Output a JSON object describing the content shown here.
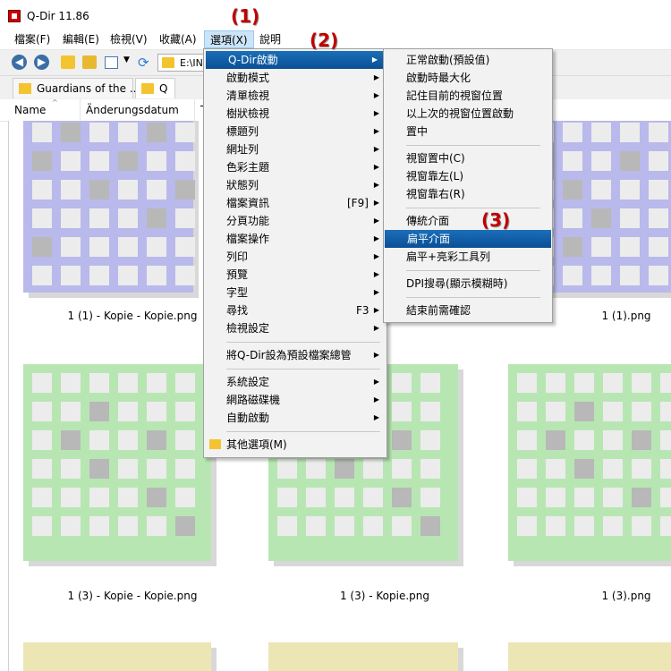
{
  "window": {
    "title": "Q-Dir 11.86"
  },
  "menubar": {
    "items": [
      {
        "label": "檔案(F)"
      },
      {
        "label": "編輯(E)"
      },
      {
        "label": "檢視(V)"
      },
      {
        "label": "收藏(A)"
      },
      {
        "label": "選項(X)"
      },
      {
        "label": "說明"
      }
    ]
  },
  "toolbar": {
    "address": "E:\\INI"
  },
  "tabs": [
    {
      "label": "Guardians of the ..."
    },
    {
      "label": "Q"
    }
  ],
  "columns": [
    {
      "label": "Name"
    },
    {
      "label": "Änderungsdatum"
    },
    {
      "label": "T"
    }
  ],
  "files": [
    {
      "name": "1 (1) - Kopie - Kopie.png"
    },
    {
      "name": "1 (1).png"
    },
    {
      "name": "1 (3) - Kopie - Kopie.png"
    },
    {
      "name": "1 (3) - Kopie.png"
    },
    {
      "name": "1 (3).png"
    }
  ],
  "options_menu": {
    "items": [
      {
        "label": "Q-Dir啟動",
        "submenu": true
      },
      {
        "label": "啟動模式",
        "submenu": true
      },
      {
        "label": "清單檢視",
        "submenu": true
      },
      {
        "label": "樹狀檢視",
        "submenu": true
      },
      {
        "label": "標題列",
        "submenu": true
      },
      {
        "label": "網址列",
        "submenu": true
      },
      {
        "label": "色彩主題",
        "submenu": true
      },
      {
        "label": "狀態列",
        "submenu": true
      },
      {
        "label": "檔案資訊",
        "shortcut": "[F9]",
        "submenu": true
      },
      {
        "label": "分頁功能",
        "submenu": true
      },
      {
        "label": "檔案操作",
        "submenu": true
      },
      {
        "label": "列印",
        "submenu": true
      },
      {
        "label": "預覽",
        "submenu": true
      },
      {
        "label": "字型",
        "submenu": true
      },
      {
        "label": "尋找",
        "shortcut": "F3",
        "submenu": true
      },
      {
        "label": "檢視設定",
        "submenu": true
      },
      {
        "label": "將Q-Dir設為預設檔案總管",
        "submenu": true
      },
      {
        "label": "系統設定",
        "submenu": true
      },
      {
        "label": "網路磁碟機",
        "submenu": true
      },
      {
        "label": "自動啟動",
        "submenu": true
      },
      {
        "label": "其他選項(M)",
        "submenu": false
      }
    ]
  },
  "startup_submenu": {
    "items": [
      {
        "label": "正常啟動(預設值)"
      },
      {
        "label": "啟動時最大化"
      },
      {
        "label": "記住目前的視窗位置"
      },
      {
        "label": "以上次的視窗位置啟動"
      },
      {
        "label": "置中"
      },
      {
        "label": "視窗置中(C)"
      },
      {
        "label": "視窗靠左(L)"
      },
      {
        "label": "視窗靠右(R)"
      },
      {
        "label": "傳統介面"
      },
      {
        "label": "扁平介面"
      },
      {
        "label": "扁平+亮彩工具列"
      },
      {
        "label": "DPI搜尋(顯示模糊時)"
      },
      {
        "label": "結束前需確認"
      }
    ]
  },
  "annotations": [
    "(1)",
    "(2)",
    "(3)"
  ],
  "colors": {
    "tile_purple": "#b9b9ec",
    "tile_green": "#b8e6b3",
    "tile_yellow": "#ece6b5",
    "menu_highlight": "#0a5aa5",
    "annotation": "#c00000"
  }
}
